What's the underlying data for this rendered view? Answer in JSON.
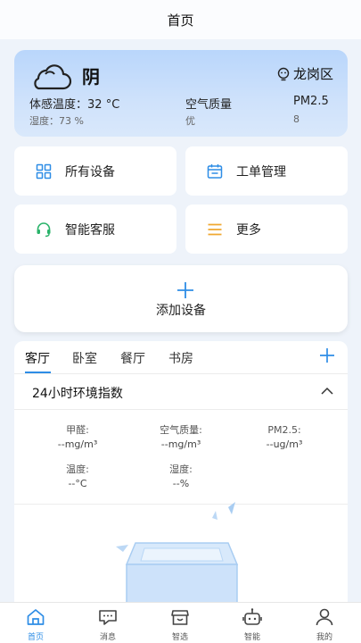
{
  "header": {
    "title": "首页"
  },
  "weather": {
    "condition": "阴",
    "location": "龙岗区",
    "feel_label": "体感温度：",
    "feel_value": "32 °C",
    "humidity_label": "湿度：",
    "humidity_value": "73 %",
    "air_quality_label": "空气质量",
    "air_quality_value": "优",
    "pm_label": "PM2.5",
    "pm_value": "8",
    "icon": "cloud-icon"
  },
  "quick_actions": [
    {
      "label": "所有设备",
      "icon": "grid-icon"
    },
    {
      "label": "工单管理",
      "icon": "calendar-icon"
    },
    {
      "label": "智能客服",
      "icon": "headset-icon"
    },
    {
      "label": "更多",
      "icon": "menu-icon"
    }
  ],
  "add_device": {
    "label": "添加设备"
  },
  "rooms": {
    "tabs": [
      "客厅",
      "卧室",
      "餐厅",
      "书房"
    ],
    "active_tab": "客厅"
  },
  "environment": {
    "title": "24小时环境指数",
    "metrics": [
      {
        "label": "甲醛:",
        "value": "--mg/m³"
      },
      {
        "label": "空气质量:",
        "value": "--mg/m³"
      },
      {
        "label": "PM2.5:",
        "value": "--ug/m³"
      },
      {
        "label": "温度:",
        "value": "--°C"
      },
      {
        "label": "湿度:",
        "value": "--%"
      }
    ]
  },
  "nav": [
    {
      "label": "首页",
      "icon": "home-icon",
      "active": true
    },
    {
      "label": "消息",
      "icon": "message-icon",
      "active": false
    },
    {
      "label": "智选",
      "icon": "store-icon",
      "active": false
    },
    {
      "label": "智能",
      "icon": "robot-icon",
      "active": false
    },
    {
      "label": "我的",
      "icon": "profile-icon",
      "active": false
    }
  ],
  "colors": {
    "accent": "#2e8de6",
    "icon_orange": "#f0a830",
    "icon_green": "#2ab36a",
    "weather_card": "#c6ddfb"
  }
}
